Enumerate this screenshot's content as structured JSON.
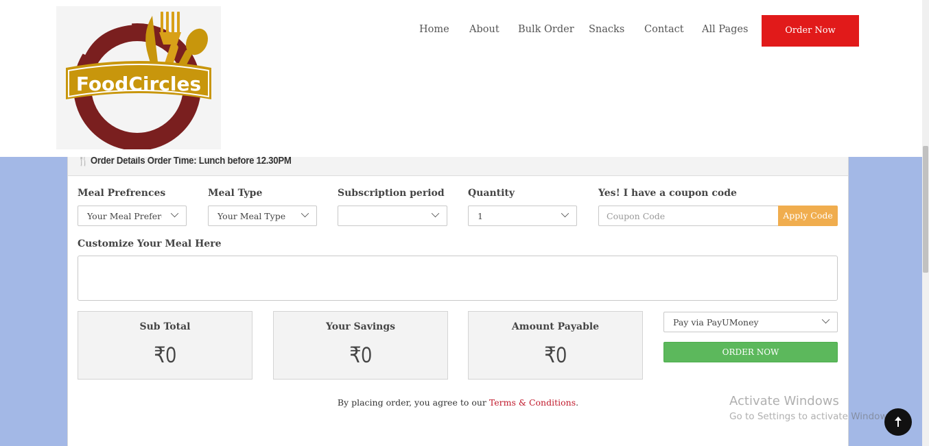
{
  "header": {
    "logo_text": "FoodCircles",
    "nav": [
      "Home",
      "About",
      "Bulk Order",
      "Snacks",
      "Contact",
      "All Pages"
    ],
    "order_now_label": "Order Now"
  },
  "panel": {
    "heading": "Order Details Order Time: Lunch before 12.30PM"
  },
  "form": {
    "meal_preferences": {
      "label": "Meal Prefrences",
      "value": "Your Meal Preferences"
    },
    "meal_type": {
      "label": "Meal Type",
      "value": "Your Meal Type"
    },
    "subscription": {
      "label": "Subscription period",
      "value": ""
    },
    "quantity": {
      "label": "Quantity",
      "value": "1"
    },
    "coupon": {
      "label": "Yes! I have a coupon code",
      "placeholder": "Coupon Code",
      "button": "Apply Code"
    },
    "customize": {
      "label": "Customize Your Meal Here"
    }
  },
  "summary": {
    "subtotal": {
      "label": "Sub Total",
      "value": "₹0"
    },
    "savings": {
      "label": "Your Savings",
      "value": "₹0"
    },
    "payable": {
      "label": "Amount Payable",
      "value": "₹0"
    }
  },
  "payment": {
    "method": "Pay via PayUMoney",
    "order_button": "ORDER NOW"
  },
  "terms": {
    "prefix": "By placing order, you agree to our ",
    "link": "Terms & Conditions",
    "suffix": "."
  },
  "watermark": {
    "title": "Activate Windows",
    "subtitle": "Go to Settings to activate Windows."
  },
  "colors": {
    "brand_red": "#e11a1a",
    "brand_gold": "#c8960c",
    "brand_maroon": "#7a1f1f",
    "coupon_button": "#f0ad4e",
    "order_button": "#5cb85c",
    "background": "#a3b8e6"
  }
}
